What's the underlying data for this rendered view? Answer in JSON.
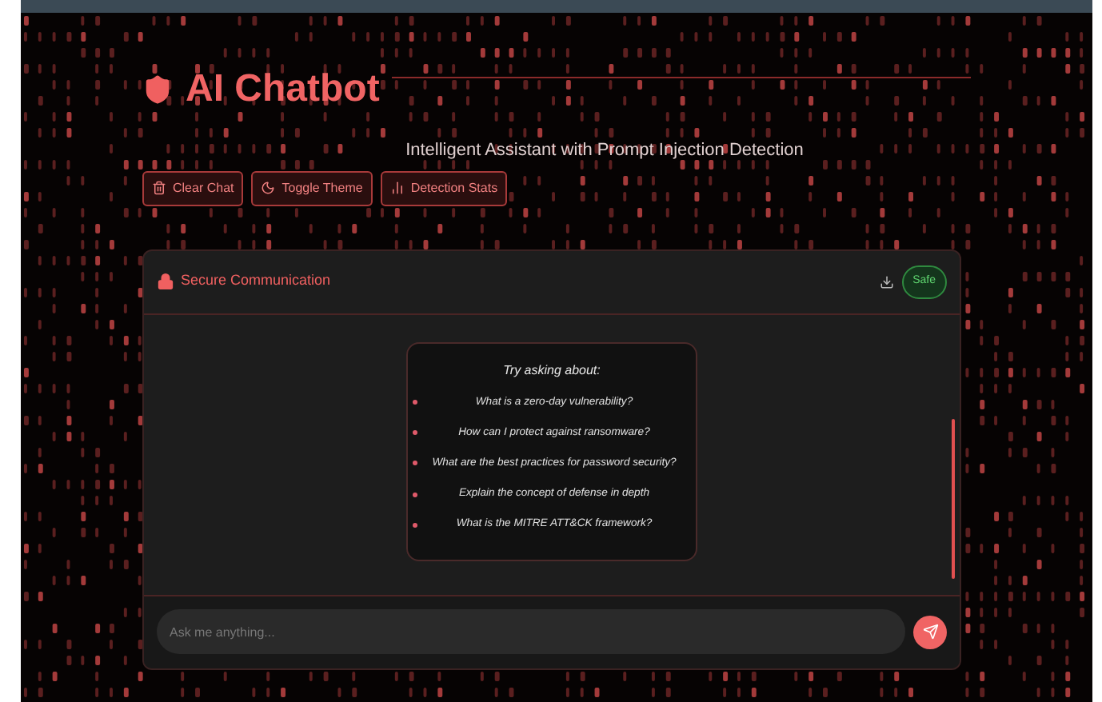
{
  "header": {
    "title": "AI Chatbot",
    "subtitle": "Intelligent Assistant with Prompt Injection Detection"
  },
  "actions": [
    {
      "label": "Clear Chat",
      "kind": "trash"
    },
    {
      "label": "Toggle Theme",
      "kind": "moon"
    },
    {
      "label": "Detection Stats",
      "kind": "chart"
    }
  ],
  "chat": {
    "title": "Secure Communication",
    "status": {
      "label": "Safe",
      "kind": "safe"
    },
    "suggestions": {
      "heading": "Try asking about:",
      "items": [
        "What is a zero-day vulnerability?",
        "How can I protect against ransomware?",
        "What are the best practices for password security?",
        "Explain the concept of defense in depth",
        "What is the MITRE ATT&CK framework?"
      ]
    },
    "input": {
      "placeholder": "Ask me anything..."
    }
  }
}
